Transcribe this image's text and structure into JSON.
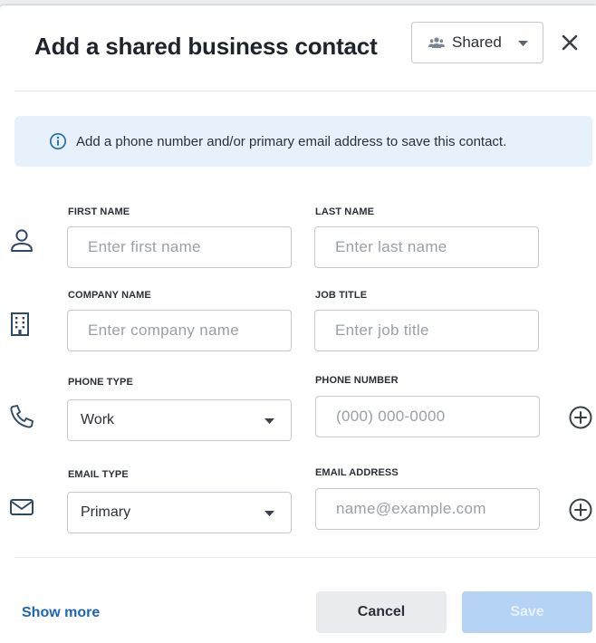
{
  "dialog": {
    "title": "Add a shared business contact",
    "visibility": {
      "selected": "Shared",
      "icon": "people-icon"
    },
    "close_icon": "close-icon"
  },
  "banner": {
    "icon": "info-icon",
    "text": "Add a phone number and/or primary email address to save this contact."
  },
  "fields": {
    "first_name": {
      "label": "FIRST NAME",
      "placeholder": "Enter first name",
      "value": ""
    },
    "last_name": {
      "label": "LAST NAME",
      "placeholder": "Enter last name",
      "value": ""
    },
    "company_name": {
      "label": "COMPANY NAME",
      "placeholder": "Enter company name",
      "value": ""
    },
    "job_title": {
      "label": "JOB TITLE",
      "placeholder": "Enter job title",
      "value": ""
    },
    "phone_type": {
      "label": "PHONE TYPE",
      "selected": "Work"
    },
    "phone_number": {
      "label": "PHONE NUMBER",
      "placeholder": "(000) 000-0000",
      "value": ""
    },
    "email_type": {
      "label": "EMAIL TYPE",
      "selected": "Primary"
    },
    "email_address": {
      "label": "EMAIL ADDRESS",
      "placeholder": "name@example.com",
      "value": ""
    }
  },
  "footer": {
    "show_more": "Show more",
    "cancel": "Cancel",
    "save": "Save"
  },
  "colors": {
    "link": "#1c66b7",
    "banner_bg": "#e6f1fb",
    "save_disabled": "#b5d3f5",
    "cancel_bg": "#e9ebef"
  }
}
